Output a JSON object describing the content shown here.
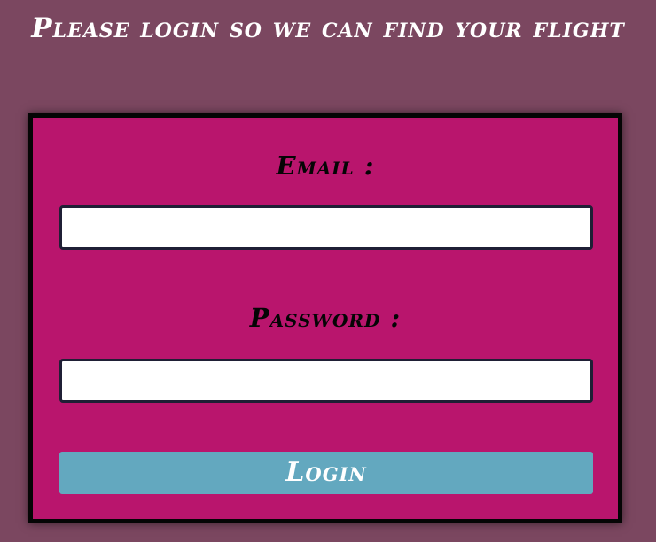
{
  "page": {
    "title": "Please login so we can find your flight"
  },
  "form": {
    "email_label": "Email :",
    "email_value": "",
    "password_label": "Password :",
    "password_value": "",
    "login_label": "Login"
  },
  "colors": {
    "background": "#7b4760",
    "card": "#b9156d",
    "button": "#63a8bf",
    "title_text": "#ffffff",
    "label_text": "#050505"
  }
}
